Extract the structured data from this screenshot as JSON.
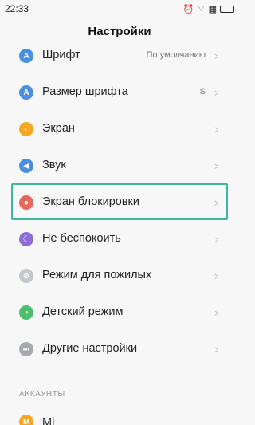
{
  "status": {
    "time": "22:33",
    "battery": "battery-icon",
    "wifi": "wifi-icon",
    "alarm": "alarm-icon"
  },
  "header": {
    "title": "Настройки"
  },
  "items": [
    {
      "label": "Шрифт",
      "value": "По умолчанию",
      "icon": "A",
      "color": "#4a90e2"
    },
    {
      "label": "Размер шрифта",
      "value": "S",
      "icon": "A",
      "color": "#4a90e2"
    },
    {
      "label": "Экран",
      "value": "",
      "icon": "◐",
      "color": "#f5a623"
    },
    {
      "label": "Звук",
      "value": "",
      "icon": "◀",
      "color": "#4a90e2"
    },
    {
      "label": "Экран блокировки",
      "value": "",
      "icon": "●",
      "color": "#e8675b"
    },
    {
      "label": "Не беспокоить",
      "value": "",
      "icon": "☾",
      "color": "#8f6bd6"
    },
    {
      "label": "Режим для пожилых",
      "value": "",
      "icon": "⊘",
      "color": "#c3c6cc"
    },
    {
      "label": "Детский режим",
      "value": "",
      "icon": "◔",
      "color": "#4cbf6a"
    },
    {
      "label": "Другие настройки",
      "value": "",
      "icon": "•••",
      "color": "#a7a9b0"
    }
  ],
  "section": {
    "label": "АККАУНТЫ"
  },
  "partial_item": {
    "label": "Mi",
    "color": "#f5a623"
  }
}
